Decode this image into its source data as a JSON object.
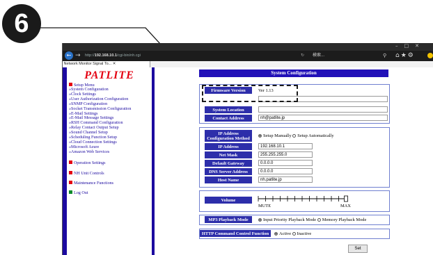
{
  "callout": {
    "step_number": "6"
  },
  "browser": {
    "url_prefix": "http://",
    "url_host": "192.168.10.1",
    "url_path": "/cgi-bin/nh.cgi",
    "search_placeholder": "検索...",
    "tab_title": "Network Monitor Signal To...",
    "refresh_glyph": "↻",
    "search_glyph": "⚲"
  },
  "sidebar": {
    "logo": "PATLITE",
    "setup_menu_title": "Setup Menu",
    "setup_items": [
      "»System Configuration",
      "»Clock Settings",
      "»User Authorization Configuration",
      "»SNMP Configuration",
      "»Socket Transmission Configuration",
      "»E-Mail Settings",
      "»E-Mail Message Settings",
      "»RSH Command Configuration",
      "»Relay Contact Output Setup",
      "»Sound Channel Setup",
      "»Scheduling Function Setup",
      "»Cloud Connection Settings",
      " »Microsoft Azure",
      " »Amazon Web Services"
    ],
    "operation_settings": "Operation Settings",
    "nh_unit_controls": "NH Unit Controls",
    "maintenance_functions": "Maintenance Functions",
    "log_out": "Log Out"
  },
  "main": {
    "header": "System Configuration",
    "firmware_label": "Firmware Version",
    "firmware_value": "Ver 1.13",
    "system_location_label": "System Location",
    "system_location_value": "",
    "contact_address_label": "Contact Address",
    "contact_address_value": "nh@patlite.jp",
    "ip_method_label": "IP Address Configuration Method",
    "ip_method_options": [
      "Setup Manually",
      "Setup Automatically"
    ],
    "ip_method_selected": "Setup Manually",
    "ip_address_label": "IP Address",
    "ip_address_value": "192.168.10.1",
    "netmask_label": "Net Mask",
    "netmask_value": "255.255.255.0",
    "gateway_label": "Default Gateway",
    "gateway_value": "0.0.0.0",
    "dns_label": "DNS Server Address",
    "dns_value": "0.0.0.0",
    "hostname_label": "Host Name",
    "hostname_value": "nh.patlite.jp",
    "volume_label": "Volume",
    "volume_min": "MUTE",
    "volume_max": "MAX",
    "volume_level": 1.0,
    "mp3_label": "MP3 Playback Mode",
    "mp3_options": [
      "Input Priority Playback Mode",
      "Memory Playback Mode"
    ],
    "mp3_selected": "Input Priority Playback Mode",
    "http_label": "HTTP Command Control Function",
    "http_options": [
      "Active",
      "Inactive"
    ],
    "http_selected": "Active",
    "set_button": "Set"
  }
}
